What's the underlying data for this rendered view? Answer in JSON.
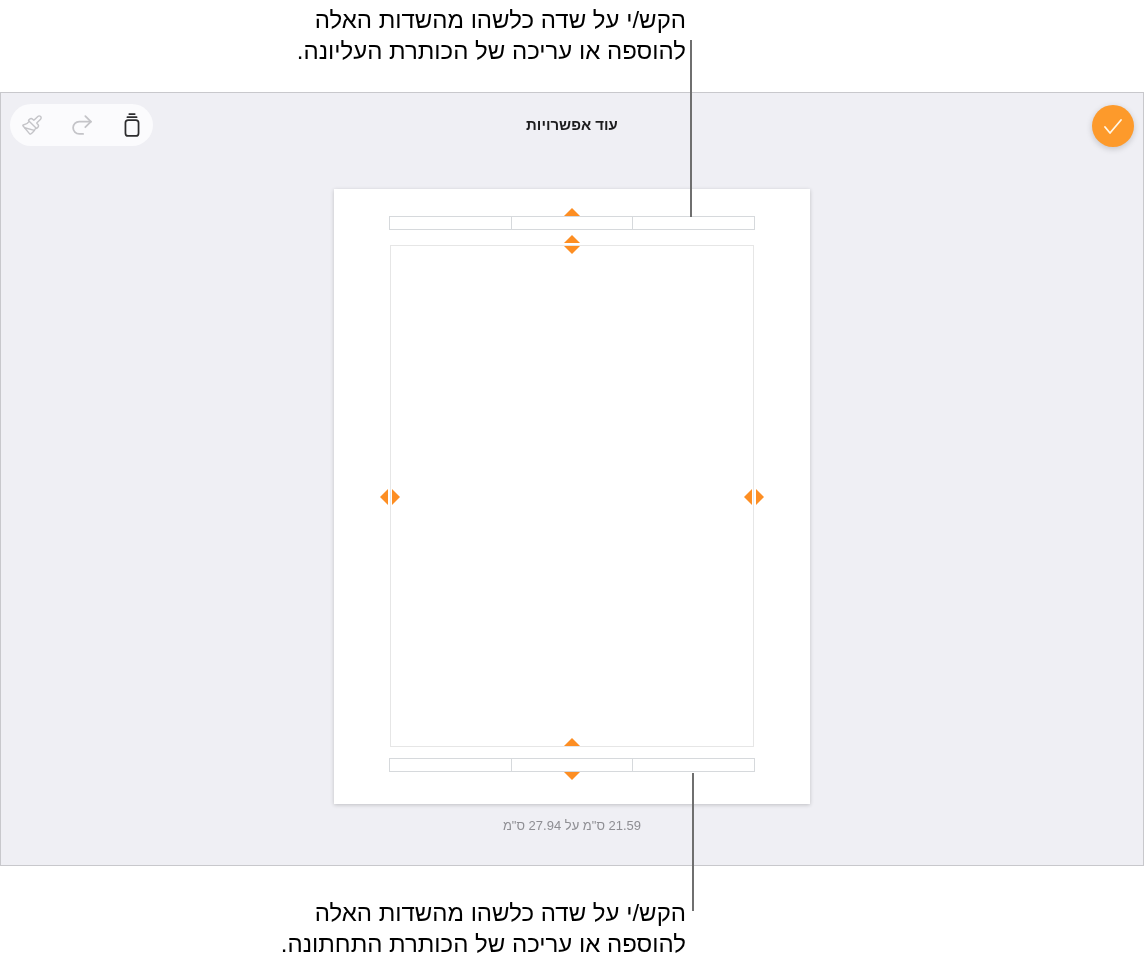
{
  "top_callout": {
    "lines": [
      "הקש/י על שדה כלשהו מהשדות האלה",
      "להוספה או עריכה של הכותרת העליונה."
    ]
  },
  "toolbar": [
    {
      "kind": "brush",
      "disabled": true
    },
    {
      "kind": "redo",
      "disabled": true
    },
    {
      "kind": "copy",
      "disabled": false
    }
  ],
  "title": "עוד אפשרויות",
  "page_size": "21.59 ס\"מ על 27.94 ס\"מ",
  "bottom_callout": {
    "lines": [
      "הקש/י על שדה כלשהו מהשדות האלה",
      "להוספה או עריכה של הכותרת התחתונה."
    ]
  }
}
